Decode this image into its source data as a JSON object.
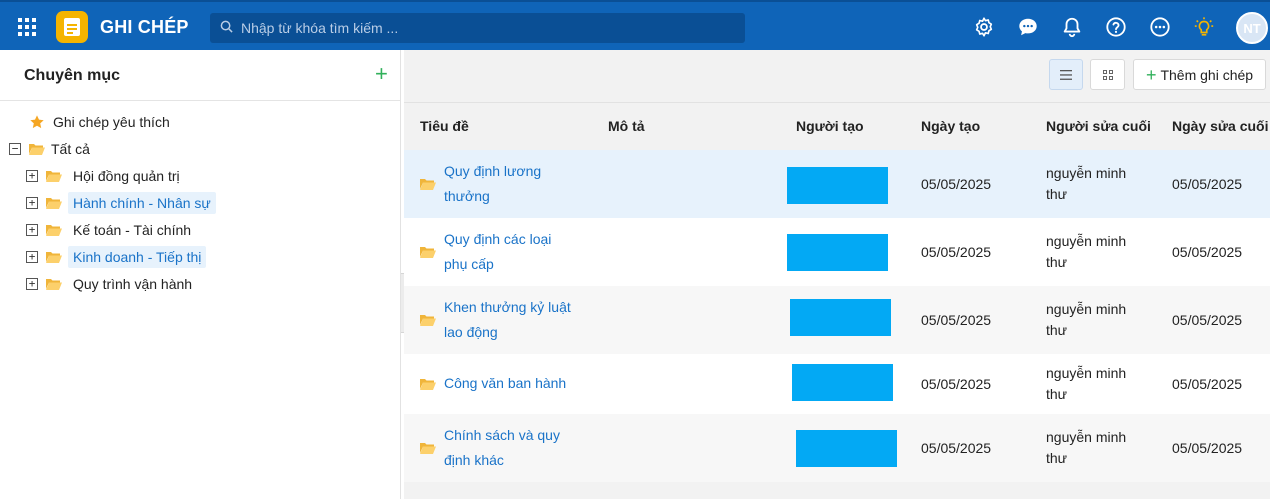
{
  "app": {
    "title": "GHI CHÉP",
    "search_placeholder": "Nhập từ khóa tìm kiếm ...",
    "avatar_initials": "NT",
    "accent_color": "#0f64b8"
  },
  "sidebar": {
    "title": "Chuyên mục",
    "add_label": "+",
    "favorites_label": "Ghi chép yêu thích",
    "all_label": "Tất cả",
    "all_expander": "−",
    "categories": [
      {
        "label": "Hội đồng quản trị",
        "expander": "+",
        "selected": false
      },
      {
        "label": "Hành chính - Nhân sự",
        "expander": "+",
        "selected": true
      },
      {
        "label": "Kế toán - Tài chính",
        "expander": "+",
        "selected": false
      },
      {
        "label": "Kinh doanh - Tiếp thị",
        "expander": "+",
        "selected": true
      },
      {
        "label": "Quy trình vận hành",
        "expander": "+",
        "selected": false
      }
    ]
  },
  "toolbar": {
    "add_note_label": "Thêm ghi chép",
    "add_note_plus": "+"
  },
  "table": {
    "headers": {
      "title": "Tiêu đề",
      "description": "Mô tả",
      "creator": "Người tạo",
      "created_date": "Ngày tạo",
      "last_editor": "Người sửa cuối",
      "modified_date": "Ngày sửa cuối"
    },
    "rows": [
      {
        "title_l1": "Quy định lương",
        "title_l2": "thưởng",
        "created": "05/05/2025",
        "editor_l1": "nguyễn minh",
        "editor_l2": "thư",
        "modified": "05/05/2025"
      },
      {
        "title_l1": "Quy định các loại",
        "title_l2": "phụ cấp",
        "created": "05/05/2025",
        "editor_l1": "nguyễn minh",
        "editor_l2": "thư",
        "modified": "05/05/2025"
      },
      {
        "title_l1": "Khen thưởng kỷ luật",
        "title_l2": "lao động",
        "created": "05/05/2025",
        "editor_l1": "nguyễn minh",
        "editor_l2": "thư",
        "modified": "05/05/2025"
      },
      {
        "title_l1": "Công văn ban hành",
        "title_l2": "",
        "created": "05/05/2025",
        "editor_l1": "nguyễn minh",
        "editor_l2": "thư",
        "modified": "05/05/2025"
      },
      {
        "title_l1": "Chính sách và quy",
        "title_l2": "định khác",
        "created": "05/05/2025",
        "editor_l1": "nguyễn minh",
        "editor_l2": "thư",
        "modified": "05/05/2025"
      }
    ]
  }
}
